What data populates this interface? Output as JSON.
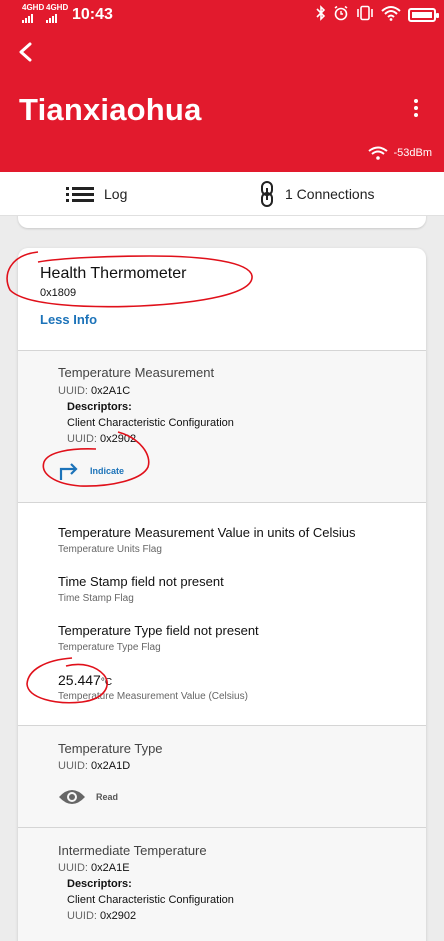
{
  "status_bar": {
    "signal1_label": "4GHD",
    "signal2_label": "4GHD",
    "time": "10:43",
    "icons": [
      "bluetooth-icon",
      "alarm-icon",
      "vibrate-icon",
      "wifi-icon",
      "battery-icon"
    ]
  },
  "header": {
    "title": "Tianxiaohua",
    "rssi": "-53dBm",
    "back_icon": "arrow-back-icon",
    "menu_icon": "more-vertical-icon"
  },
  "tabs": {
    "log_label": "Log",
    "connections_label": "1 Connections"
  },
  "service": {
    "name": "Health Thermometer",
    "uuid": "0x1809",
    "toggle_label": "Less Info"
  },
  "characteristics": [
    {
      "name": "Temperature Measurement",
      "uuid_label": "UUID:",
      "uuid": "0x2A1C",
      "descriptors_label": "Descriptors:",
      "descriptor_name": "Client Characteristic Configuration",
      "descriptor_uuid": "0x2902",
      "action": "Indicate"
    },
    {
      "name": "Temperature Type",
      "uuid_label": "UUID:",
      "uuid": "0x2A1D",
      "action": "Read"
    },
    {
      "name": "Intermediate Temperature",
      "uuid_label": "UUID:",
      "uuid": "0x2A1E",
      "descriptors_label": "Descriptors:",
      "descriptor_name": "Client Characteristic Configuration",
      "descriptor_uuid": "0x2902"
    }
  ],
  "fields": [
    {
      "value": "Temperature Measurement Value in units of Celsius",
      "label": "Temperature Units Flag"
    },
    {
      "value": "Time Stamp field not present",
      "label": "Time Stamp Flag"
    },
    {
      "value": "Temperature Type field not present",
      "label": "Temperature Type Flag"
    }
  ],
  "reading": {
    "value": "25.447",
    "unit": "°C",
    "label": "Temperature Measurement Value (Celsius)"
  },
  "colors": {
    "header": "#e21a2d",
    "link": "#1c73b9",
    "annotation": "#e0101a"
  }
}
